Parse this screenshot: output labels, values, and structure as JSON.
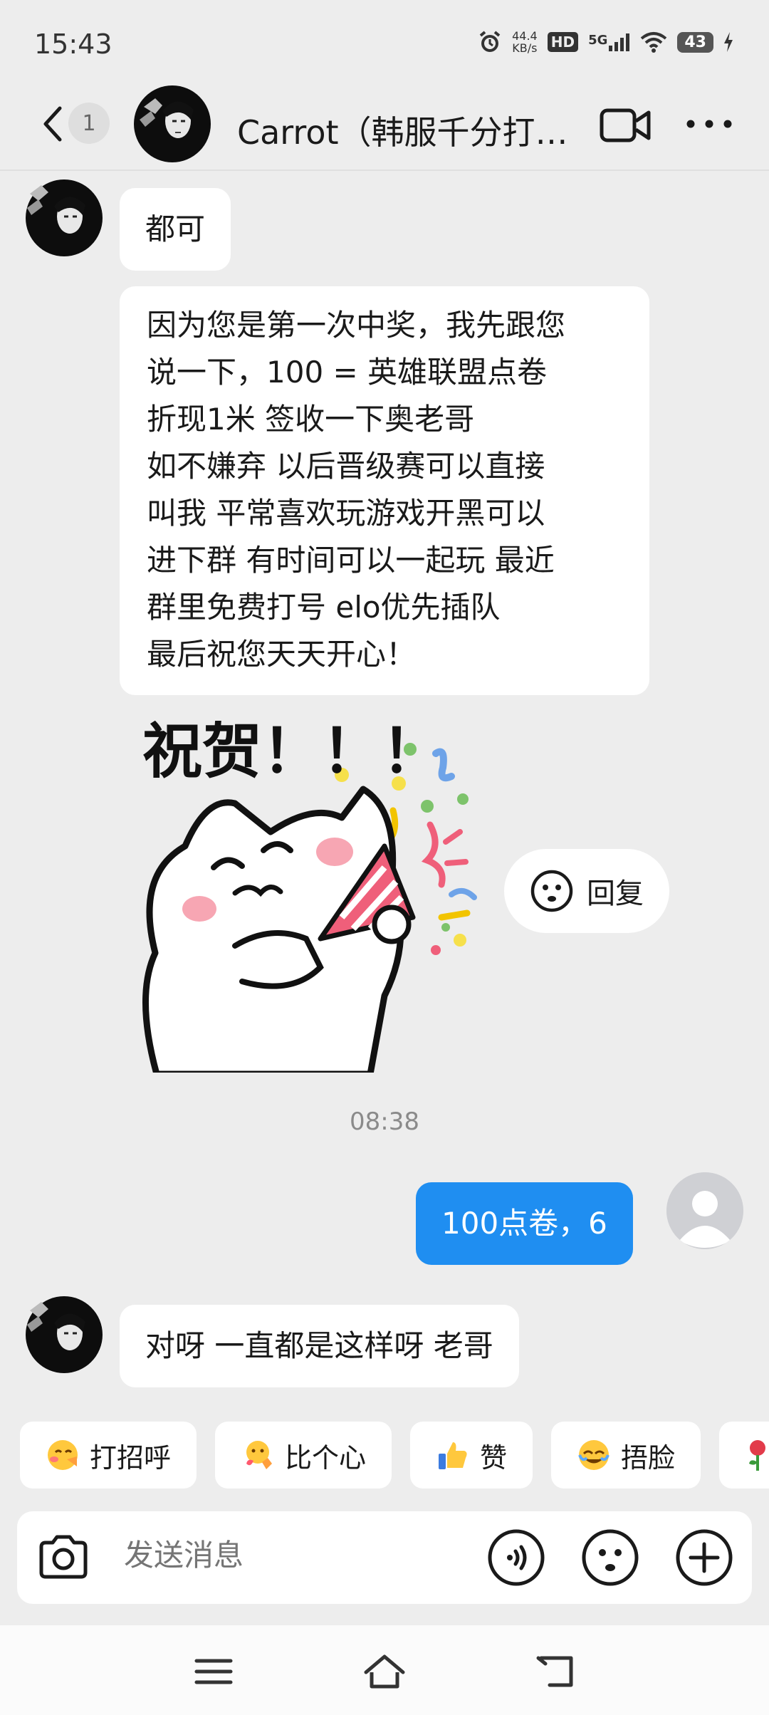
{
  "status_bar": {
    "time": "15:43",
    "net_speed_value": "44.4",
    "net_speed_unit": "KB/s",
    "hd": "HD",
    "signal": "5G",
    "battery": "43"
  },
  "header": {
    "unread_count": "1",
    "title": "Carrot（韩服千分打…"
  },
  "messages": [
    {
      "from": "other",
      "text": "都可"
    },
    {
      "from": "other",
      "text": "因为您是第一次中奖，我先跟您\n说一下，100 = 英雄联盟点卷\n折现1米 签收一下奥老哥\n 如不嫌弃  以后晋级赛可以直接\n叫我  平常喜欢玩游戏开黑可以\n进下群 有时间可以一起玩  最近\n群里免费打号 elo优先插队\n 最后祝您天天开心！"
    },
    {
      "from": "other",
      "sticker_text": "祝贺！！！"
    },
    {
      "timestamp": "08:38"
    },
    {
      "from": "me",
      "text": "100点卷，6"
    },
    {
      "from": "other",
      "text": "对呀 一直都是这样呀 老哥"
    }
  ],
  "reply_button": {
    "label": "回复"
  },
  "quick_replies": [
    {
      "label": "打招呼",
      "icon": "wave-emoji-icon"
    },
    {
      "label": "比个心",
      "icon": "heart-hand-emoji-icon"
    },
    {
      "label": "赞",
      "icon": "thumbs-up-emoji-icon"
    },
    {
      "label": "捂脸",
      "icon": "facepalm-emoji-icon"
    },
    {
      "label": "",
      "icon": "rose-emoji-icon"
    }
  ],
  "input": {
    "placeholder": "发送消息"
  },
  "colors": {
    "accent": "#1f8ef1",
    "background": "#ededed"
  }
}
